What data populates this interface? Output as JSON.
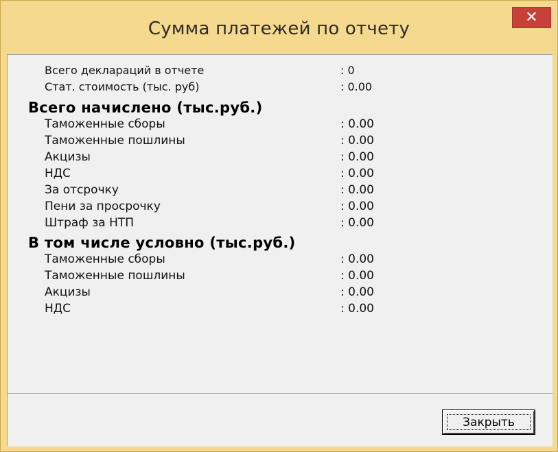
{
  "window": {
    "title": "Сумма платежей по отчету",
    "close_glyph": "✕"
  },
  "summary": [
    {
      "label": "Всего деклараций в отчете",
      "value": ": 0"
    },
    {
      "label": "Стат. стоимость (тыс. руб)",
      "value": ": 0.00"
    }
  ],
  "accrued": {
    "heading": "Всего начислено (тыс.руб.)",
    "items": [
      {
        "label": "Таможенные сборы",
        "value": ": 0.00"
      },
      {
        "label": "Таможенные пошлины",
        "value": ": 0.00"
      },
      {
        "label": "Акцизы",
        "value": ": 0.00"
      },
      {
        "label": "НДС",
        "value": ": 0.00"
      },
      {
        "label": "За отсрочку",
        "value": ": 0.00"
      },
      {
        "label": "Пени за просрочку",
        "value": ": 0.00"
      },
      {
        "label": "Штраф за НТП",
        "value": ": 0.00"
      }
    ]
  },
  "conditional": {
    "heading": "В том числе условно (тыс.руб.)",
    "items": [
      {
        "label": "Таможенные сборы",
        "value": ": 0.00"
      },
      {
        "label": "Таможенные пошлины",
        "value": ": 0.00"
      },
      {
        "label": "Акцизы",
        "value": ": 0.00"
      },
      {
        "label": "НДС",
        "value": ": 0.00"
      }
    ]
  },
  "footer": {
    "close_button_label": "Закрыть"
  },
  "colors": {
    "titlebar": "#f4d98e",
    "close_button": "#c7403a",
    "client_background": "#f0f0f0"
  }
}
